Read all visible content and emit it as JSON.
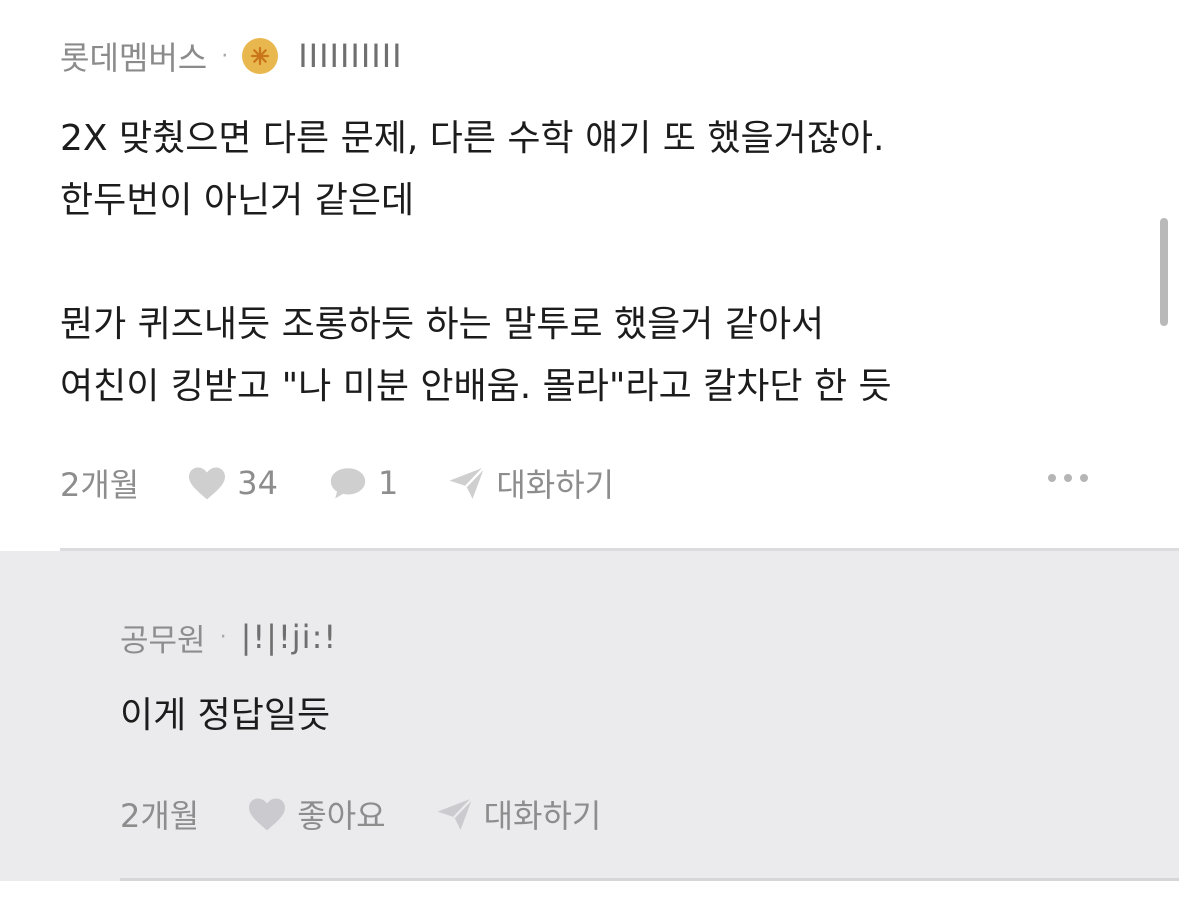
{
  "main_comment": {
    "author": "롯데멤버스",
    "separator": "·",
    "user_id_masked": "ⅠⅠⅠⅠⅠⅠⅠⅠⅠⅠ",
    "body": "2X 맞췄으면 다른 문제, 다른 수학 얘기 또 했을거잖아.\n한두번이 아닌거 같은데\n\n뭔가 퀴즈내듯 조롱하듯 하는 말투로 했을거 같아서\n여친이 킹받고 \"나 미분 안배움. 몰라\"라고 칼차단 한 듯",
    "time": "2개월",
    "likes": "34",
    "replies": "1",
    "chat_label": "대화하기"
  },
  "reply_comment": {
    "author": "공무원",
    "separator": "·",
    "user_id_masked": "|!|!ji:!",
    "body": "이게 정답일듯",
    "time": "2개월",
    "like_label": "좋아요",
    "chat_label": "대화하기"
  },
  "colors": {
    "badge": "#e8b84f",
    "reply_bg": "#ebebee",
    "meta_text": "#8d8d8d"
  }
}
